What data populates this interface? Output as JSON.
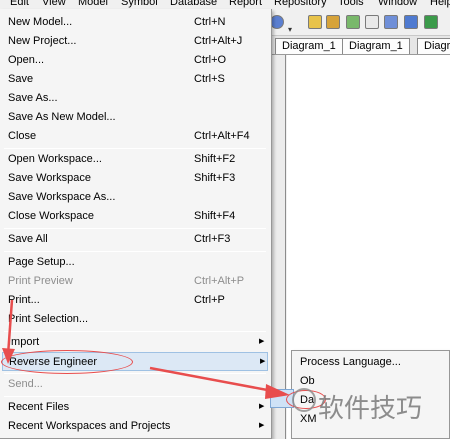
{
  "menubar": {
    "items": [
      "Edit",
      "View",
      "Model",
      "Symbol",
      "Database",
      "Report",
      "Repository",
      "Tools",
      "Window",
      "Help"
    ]
  },
  "tabs": [
    "Diagram_1",
    "Diagram_1",
    "Diagra"
  ],
  "file_menu": {
    "items": [
      {
        "label": "New Model...",
        "shortcut": "Ctrl+N"
      },
      {
        "label": "New Project...",
        "shortcut": "Ctrl+Alt+J"
      },
      {
        "label": "Open...",
        "shortcut": "Ctrl+O"
      },
      {
        "label": "Save",
        "shortcut": "Ctrl+S"
      },
      {
        "label": "Save As...",
        "shortcut": ""
      },
      {
        "label": "Save As New Model...",
        "shortcut": ""
      },
      {
        "label": "Close",
        "shortcut": "Ctrl+Alt+F4"
      },
      {
        "label": "Open Workspace...",
        "shortcut": "Shift+F2"
      },
      {
        "label": "Save Workspace",
        "shortcut": "Shift+F3"
      },
      {
        "label": "Save Workspace As...",
        "shortcut": ""
      },
      {
        "label": "Close Workspace",
        "shortcut": "Shift+F4"
      },
      {
        "label": "Save All",
        "shortcut": "Ctrl+F3"
      },
      {
        "label": "Page Setup...",
        "shortcut": ""
      },
      {
        "label": "Print Preview",
        "shortcut": "Ctrl+Alt+P"
      },
      {
        "label": "Print...",
        "shortcut": "Ctrl+P"
      },
      {
        "label": "Print Selection...",
        "shortcut": ""
      },
      {
        "label": "Import",
        "shortcut": ""
      },
      {
        "label": "Reverse Engineer",
        "shortcut": ""
      },
      {
        "label": "Send...",
        "shortcut": ""
      },
      {
        "label": "Recent Files",
        "shortcut": ""
      },
      {
        "label": "Recent Workspaces and Projects",
        "shortcut": ""
      }
    ]
  },
  "reverse_engineer_submenu": {
    "items": [
      "Process Language...",
      "Ob",
      "Da",
      "XM"
    ]
  },
  "watermark": {
    "text": "软件技巧"
  },
  "colors": {
    "annotation_red": "#e84d4d",
    "highlight": "#dce8f5"
  }
}
